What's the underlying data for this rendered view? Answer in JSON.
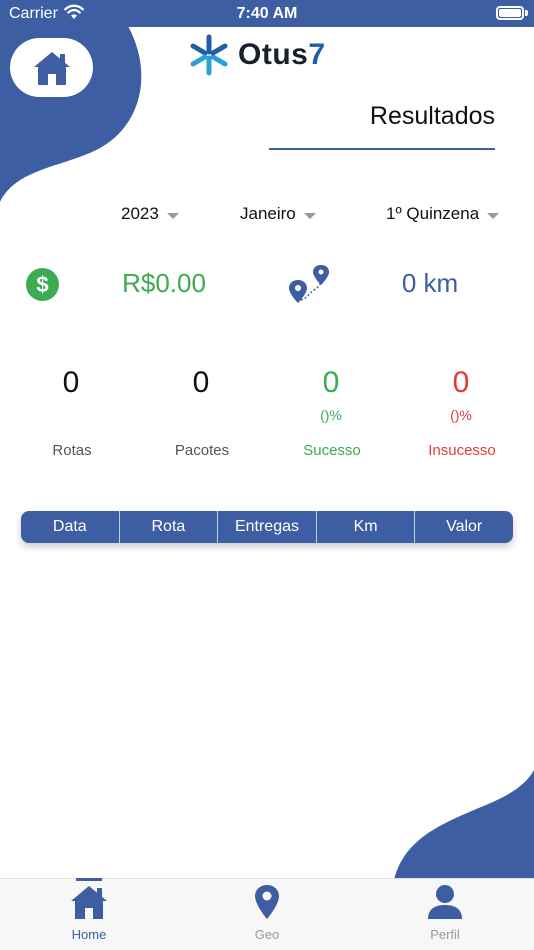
{
  "status_bar": {
    "carrier": "Carrier",
    "time": "7:40 AM"
  },
  "header": {
    "logo_text": "Otus",
    "logo_number": "7",
    "title": "Resultados"
  },
  "filters": {
    "year": "2023",
    "month": "Janeiro",
    "period": "1º Quinzena"
  },
  "summary": {
    "money": "R$0.00",
    "money_symbol": "$",
    "distance": "0 km"
  },
  "stats": [
    {
      "value": "0",
      "percent": "",
      "label": "Rotas"
    },
    {
      "value": "0",
      "percent": "",
      "label": "Pacotes"
    },
    {
      "value": "0",
      "percent": "()%",
      "label": "Sucesso"
    },
    {
      "value": "0",
      "percent": "()%",
      "label": "Insucesso"
    }
  ],
  "table": {
    "columns": [
      "Data",
      "Rota",
      "Entregas",
      "Km",
      "Valor"
    ]
  },
  "tabs": [
    {
      "label": "Home",
      "icon": "home-icon",
      "active": true
    },
    {
      "label": "Geo",
      "icon": "map-pin-icon",
      "active": false
    },
    {
      "label": "Perfil",
      "icon": "person-icon",
      "active": false
    }
  ],
  "colors": {
    "primary": "#3d5ea3",
    "success": "#3dab51",
    "failure": "#e53935",
    "inactive": "#9a9a9a"
  }
}
